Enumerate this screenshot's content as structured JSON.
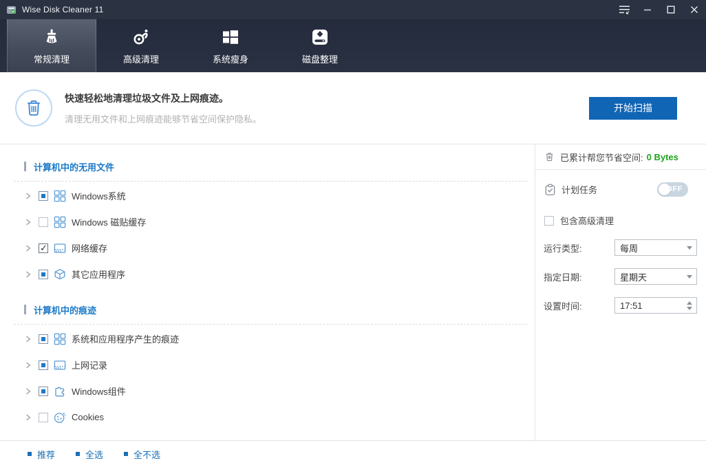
{
  "titlebar": {
    "title": "Wise Disk Cleaner 11"
  },
  "nav": {
    "tabs": [
      {
        "label": "常规清理",
        "icon": "broom-icon",
        "state": "active"
      },
      {
        "label": "高级清理",
        "icon": "advanced-clean-icon",
        "state": "inactive"
      },
      {
        "label": "系统瘦身",
        "icon": "windows-logo-icon",
        "state": "inactive"
      },
      {
        "label": "磁盘整理",
        "icon": "disk-icon",
        "state": "inactive"
      }
    ]
  },
  "header": {
    "title": "快速轻松地清理垃圾文件及上网痕迹。",
    "subtitle": "清理无用文件和上网痕迹能够节省空间保护隐私。",
    "scan_button": "开始扫描",
    "icon": "trash-icon"
  },
  "tree": {
    "sections": [
      {
        "title": "计算机中的无用文件",
        "items": [
          {
            "label": "Windows系统",
            "checkbox": "partial",
            "icon": "windows-tiles-icon"
          },
          {
            "label": "Windows 磁贴缓存",
            "checkbox": "unchecked",
            "icon": "windows-tiles-icon"
          },
          {
            "label": "网络缓存",
            "checkbox": "checked",
            "icon": "browser-window-icon"
          },
          {
            "label": "其它应用程序",
            "checkbox": "partial",
            "icon": "cube-icon"
          }
        ]
      },
      {
        "title": "计算机中的痕迹",
        "items": [
          {
            "label": "系统和应用程序产生的痕迹",
            "checkbox": "partial",
            "icon": "windows-tiles-icon"
          },
          {
            "label": "上网记录",
            "checkbox": "partial",
            "icon": "browser-window-icon"
          },
          {
            "label": "Windows组件",
            "checkbox": "partial",
            "icon": "puzzle-icon"
          },
          {
            "label": "Cookies",
            "checkbox": "unchecked",
            "icon": "cookie-icon"
          }
        ]
      }
    ]
  },
  "sidebar": {
    "saved_space_label": "已累计帮您节省空间:",
    "saved_space_value": "0 Bytes",
    "schedule_label": "计划任务",
    "schedule_toggle_state": "OFF",
    "include_advanced_label": "包含高级清理",
    "include_advanced_checkbox": "unchecked",
    "run_type_label": "运行类型:",
    "run_type_value": "每周",
    "day_label": "指定日期:",
    "day_value": "星期天",
    "time_label": "设置时间:",
    "time_value": "17:51"
  },
  "footer": {
    "links": [
      {
        "label": "推荐"
      },
      {
        "label": "全选"
      },
      {
        "label": "全不选"
      }
    ]
  },
  "colors": {
    "titlebar_bg": "#2b3241",
    "nav_bg": "#2a3142",
    "accent_blue": "#1165b5",
    "section_blue": "#1c7ac9",
    "link_blue": "#1a6fb5",
    "saved_green": "#1fa11f",
    "tree_icon_blue": "#5b9bd5",
    "checkbox_blue": "#1e78c8"
  }
}
